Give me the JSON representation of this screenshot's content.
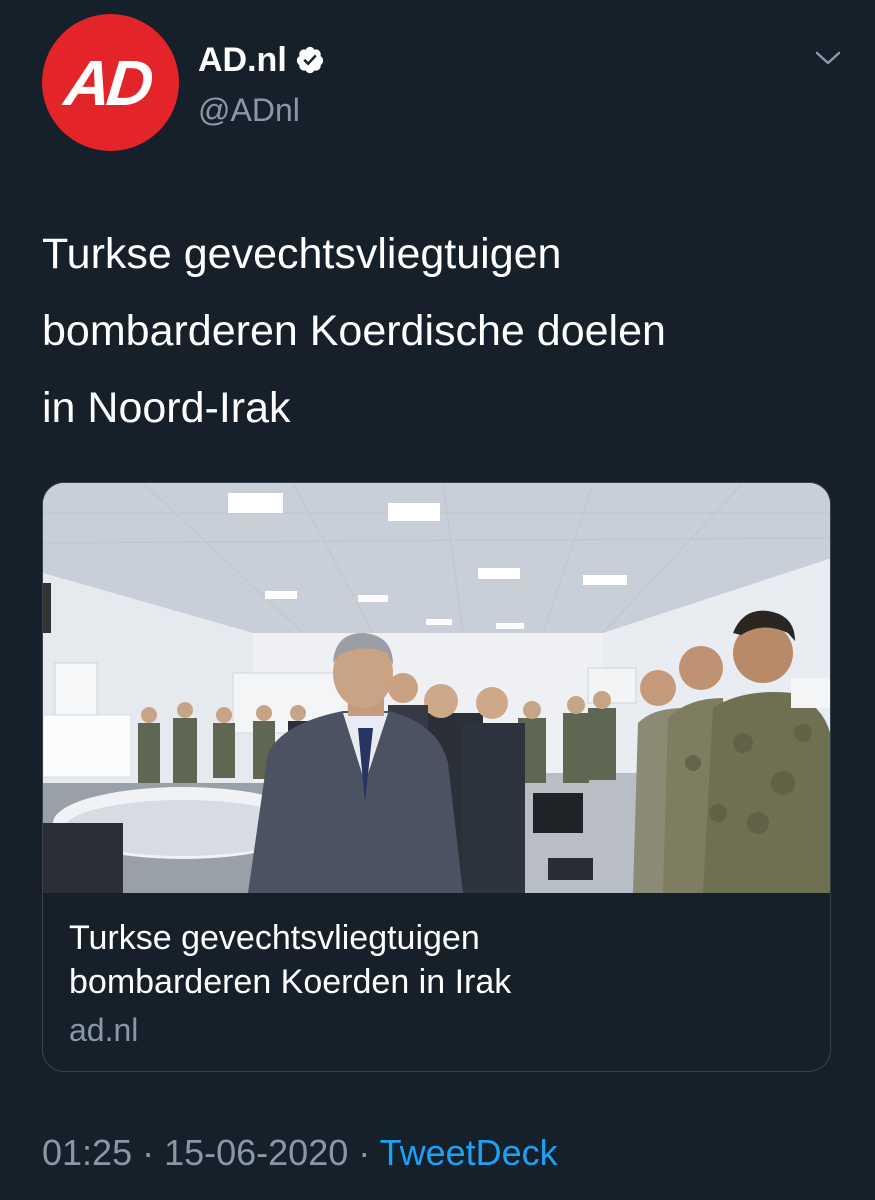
{
  "account": {
    "display_name": "AD.nl",
    "handle": "@ADnl",
    "avatar_text": "AD",
    "avatar_color": "#e3252a",
    "verified": true
  },
  "tweet": {
    "text_lines": [
      "Turkse gevechtsvliegtuigen",
      "bombarderen Koerdische doelen",
      "in Noord-Irak"
    ]
  },
  "card": {
    "title_lines": [
      "Turkse gevechtsvliegtuigen",
      "bombarderen Koerden in Irak"
    ],
    "domain": "ad.nl"
  },
  "meta": {
    "time": "01:25",
    "separator1": " · ",
    "date": "15-06-2020",
    "separator2": " · ",
    "source": "TweetDeck"
  },
  "colors": {
    "background": "#15202b",
    "secondary_text": "#8899a6",
    "link": "#1da1f2",
    "border": "#38444d"
  },
  "icons": {
    "verified": "verified-badge-icon",
    "menu": "chevron-down-icon"
  }
}
